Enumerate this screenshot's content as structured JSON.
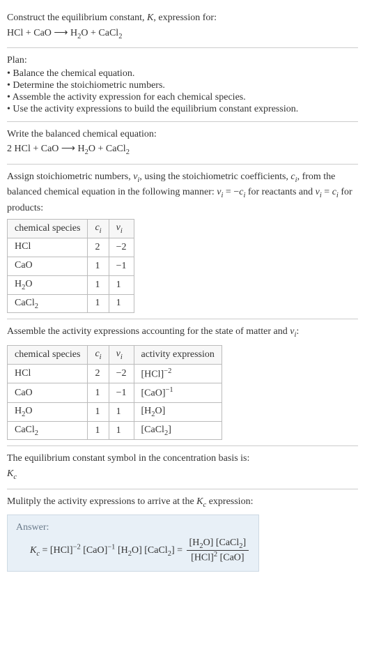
{
  "prompt": {
    "line1_a": "Construct the equilibrium constant, ",
    "line1_b": ", expression for:"
  },
  "eq_unbalanced": {
    "lhs1": "HCl",
    "plus": " + ",
    "lhs2": "CaO",
    "arrow": " ⟶ ",
    "rhs1_a": "H",
    "rhs1_sub": "2",
    "rhs1_b": "O",
    "rhs2_a": "CaCl",
    "rhs2_sub": "2"
  },
  "plan": {
    "title": "Plan:",
    "b1": "• Balance the chemical equation.",
    "b2": "• Determine the stoichiometric numbers.",
    "b3": "• Assemble the activity expression for each chemical species.",
    "b4": "• Use the activity expressions to build the equilibrium constant expression."
  },
  "balanced": {
    "title": "Write the balanced chemical equation:",
    "coef": "2 ",
    "lhs1": "HCl",
    "plus": " + ",
    "lhs2": "CaO",
    "arrow": " ⟶ ",
    "rhs1_a": "H",
    "rhs1_sub": "2",
    "rhs1_b": "O",
    "rhs2_a": "CaCl",
    "rhs2_sub": "2"
  },
  "assign": {
    "t1": "Assign stoichiometric numbers, ",
    "t2": ", using the stoichiometric coefficients, ",
    "t3": ", from the balanced chemical equation in the following manner: ",
    "t4": " = −",
    "t5": " for reactants and ",
    "t6": " = ",
    "t7": " for products:"
  },
  "tbl1": {
    "h1": "chemical species",
    "rows": [
      {
        "sp_a": "HCl",
        "sp_sub": "",
        "sp_b": "",
        "c": "2",
        "nu": "−2"
      },
      {
        "sp_a": "CaO",
        "sp_sub": "",
        "sp_b": "",
        "c": "1",
        "nu": "−1"
      },
      {
        "sp_a": "H",
        "sp_sub": "2",
        "sp_b": "O",
        "c": "1",
        "nu": "1"
      },
      {
        "sp_a": "CaCl",
        "sp_sub": "2",
        "sp_b": "",
        "c": "1",
        "nu": "1"
      }
    ]
  },
  "assemble": {
    "t1": "Assemble the activity expressions accounting for the state of matter and ",
    "t2": ":"
  },
  "tbl2": {
    "h1": "chemical species",
    "h4": "activity expression",
    "rows": [
      {
        "sp_a": "HCl",
        "sp_sub": "",
        "sp_b": "",
        "c": "2",
        "nu": "−2",
        "ax_a": "[HCl]",
        "ax_sup": "−2",
        "ax_sub": ""
      },
      {
        "sp_a": "CaO",
        "sp_sub": "",
        "sp_b": "",
        "c": "1",
        "nu": "−1",
        "ax_a": "[CaO]",
        "ax_sup": "−1",
        "ax_sub": ""
      },
      {
        "sp_a": "H",
        "sp_sub": "2",
        "sp_b": "O",
        "c": "1",
        "nu": "1",
        "ax_a": "[H",
        "ax_sup": "",
        "ax_sub": "2",
        "ax_b": "O]"
      },
      {
        "sp_a": "CaCl",
        "sp_sub": "2",
        "sp_b": "",
        "c": "1",
        "nu": "1",
        "ax_a": "[CaCl",
        "ax_sup": "",
        "ax_sub": "2",
        "ax_b": "]"
      }
    ]
  },
  "symbol": {
    "title": "The equilibrium constant symbol in the concentration basis is:"
  },
  "multiply": {
    "t1": "Mulitply the activity expressions to arrive at the ",
    "t2": " expression:"
  },
  "answer": {
    "label": "Answer:",
    "eq": " = ",
    "t_hcl": "[HCl]",
    "p_m2": "−2",
    "t_cao": "[CaO]",
    "p_m1": "−1",
    "t_h2o_a": "[H",
    "t_h2o_sub": "2",
    "t_h2o_b": "O]",
    "t_cacl_a": "[CaCl",
    "t_cacl_sub": "2",
    "t_cacl_b": "]",
    "eq2": " = ",
    "num_a": "[H",
    "num_sub1": "2",
    "num_b": "O] [CaCl",
    "num_sub2": "2",
    "num_c": "]",
    "den_a": "[HCl]",
    "den_sup": "2",
    "den_b": " [CaO]"
  },
  "sym": {
    "K": "K",
    "Kc_sub": "c",
    "nu": "ν",
    "i": "i",
    "c": "c"
  }
}
